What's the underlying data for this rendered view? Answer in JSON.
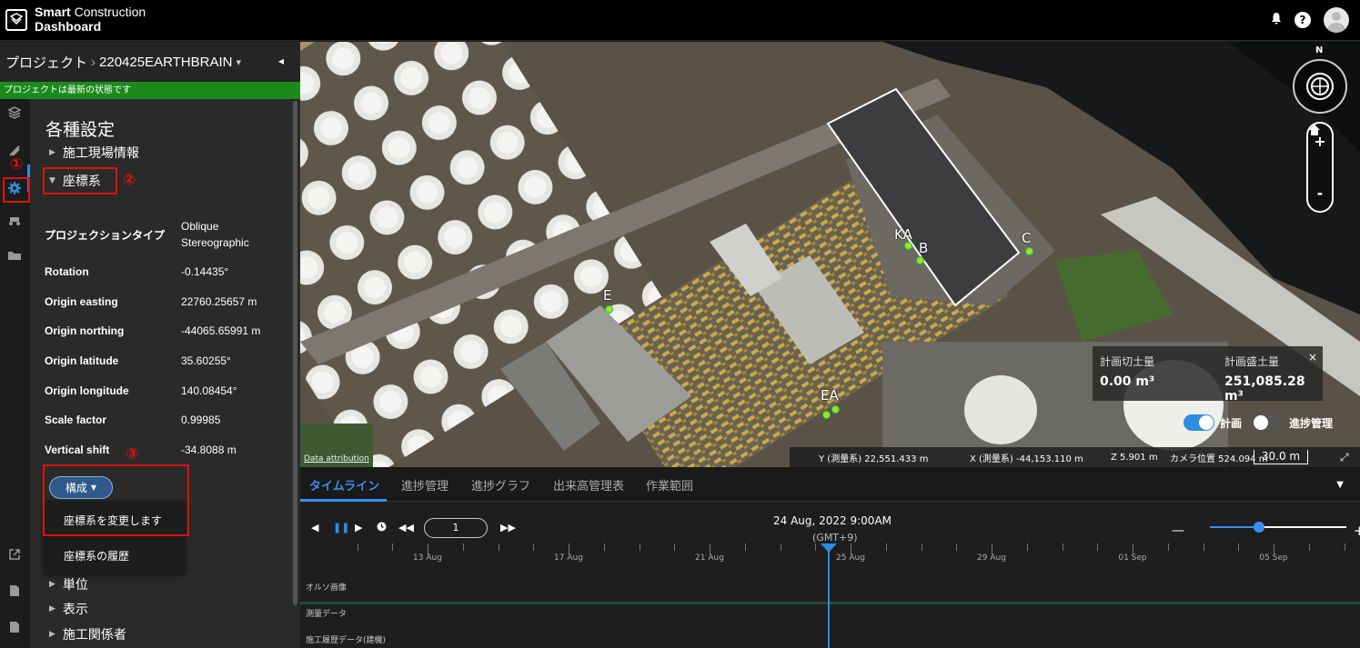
{
  "app": {
    "brand_line1_bold": "Smart",
    "brand_line1_rest": " Construction",
    "brand_line2": "Dashboard"
  },
  "topbar": {
    "bell_icon": "bell-icon",
    "help_label": "?"
  },
  "project": {
    "root_label": "プロジェクト",
    "separator": "›",
    "name": "220425EARTHBRAIN",
    "dropdown_glyph": "▾",
    "collapse_glyph": "◂",
    "status": "プロジェクトは最新の状態です"
  },
  "settings": {
    "title": "各種設定",
    "sections": {
      "site_info": "施工現場情報",
      "coordinate_system": "座標系",
      "units": "単位",
      "display": "表示",
      "stakeholders": "施工関係者"
    }
  },
  "coordinate_props": [
    {
      "label": "プロジェクションタイプ",
      "value": "Oblique Stereographic"
    },
    {
      "label": "Rotation",
      "value": "-0.14435°"
    },
    {
      "label": "Origin easting",
      "value": "22760.25657 m"
    },
    {
      "label": "Origin northing",
      "value": "-44065.65991 m"
    },
    {
      "label": "Origin latitude",
      "value": "35.60255°"
    },
    {
      "label": "Origin longitude",
      "value": "140.08454°"
    },
    {
      "label": "Scale factor",
      "value": "0.99985"
    },
    {
      "label": "Vertical shift",
      "value": "-34.8088 m"
    }
  ],
  "config_menu": {
    "button_label": "構成",
    "items": [
      "座標系を変更します",
      "座標系の履歴"
    ]
  },
  "annotations": {
    "num1": "①",
    "num2": "②",
    "num3": "③"
  },
  "map": {
    "compass_label": "N",
    "zoom_in": "+",
    "zoom_out": "-",
    "point_labels": {
      "ka": "KA",
      "b": "B",
      "c": "C",
      "e": "E",
      "ea": "EA"
    },
    "volume": {
      "cut_label": "計画切土量",
      "cut_value": "0.00 m³",
      "fill_label": "計画盛土量",
      "fill_value": "251,085.28 m³",
      "close": "×"
    },
    "toggles": {
      "plan": "計画",
      "progress": "進捗管理"
    },
    "coords": {
      "y": "Y (測量系) 22,551.433 m",
      "x": "X (測量系) -44,153.110 m",
      "z": "Z 5.901 m",
      "camera": "カメラ位置 524.094 m",
      "scale": "30.0 m",
      "expand_icon": "⤢"
    },
    "attribution": "Data attribution"
  },
  "bottom": {
    "tabs": [
      "タイムライン",
      "進捗管理",
      "進捗グラフ",
      "出来高管理表",
      "作業範囲"
    ],
    "collapse_glyph": "▼",
    "speed_value": "1",
    "datetime": "24 Aug, 2022 9:00AM",
    "timezone": "(GMT+9)",
    "zoom_minus": "—",
    "zoom_plus": "+",
    "zoom_level": 0.36,
    "dates": [
      "13 Aug",
      "17 Aug",
      "21 Aug",
      "25 Aug",
      "29 Aug",
      "01 Sep",
      "05 Sep"
    ],
    "tracks": [
      "オルソ画像",
      "測量データ",
      "施工履歴データ(建機)"
    ]
  },
  "colors": {
    "accent": "#2d8de0",
    "status_green": "#1b8a1b",
    "highlight_red": "#e01010",
    "point_green": "#9be51a"
  }
}
